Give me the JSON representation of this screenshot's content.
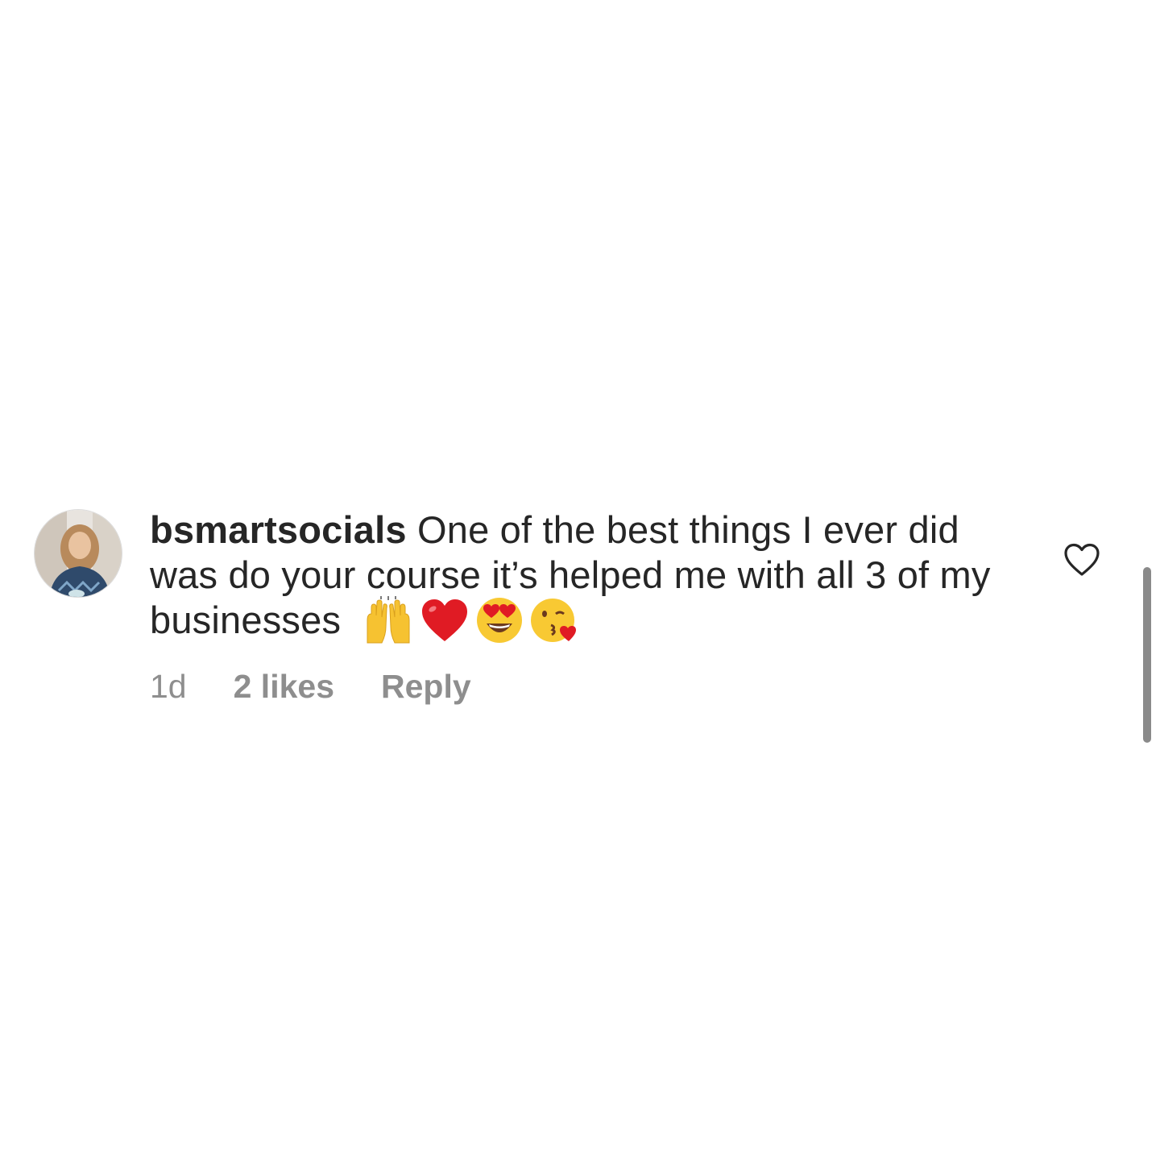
{
  "comment": {
    "username": "bsmartsocials",
    "text": "One of the best things I ever did was do your course it’s helped me with all 3 of my businesses",
    "emojis": [
      "raising-hands",
      "red-heart",
      "heart-eyes",
      "face-blowing-kiss"
    ],
    "time": "1d",
    "likes": "2 likes",
    "reply_label": "Reply"
  },
  "icons": {
    "like": "heart-outline-icon",
    "avatar": "profile-avatar"
  },
  "colors": {
    "text": "#262626",
    "meta": "#8e8e8e",
    "background": "#ffffff"
  }
}
